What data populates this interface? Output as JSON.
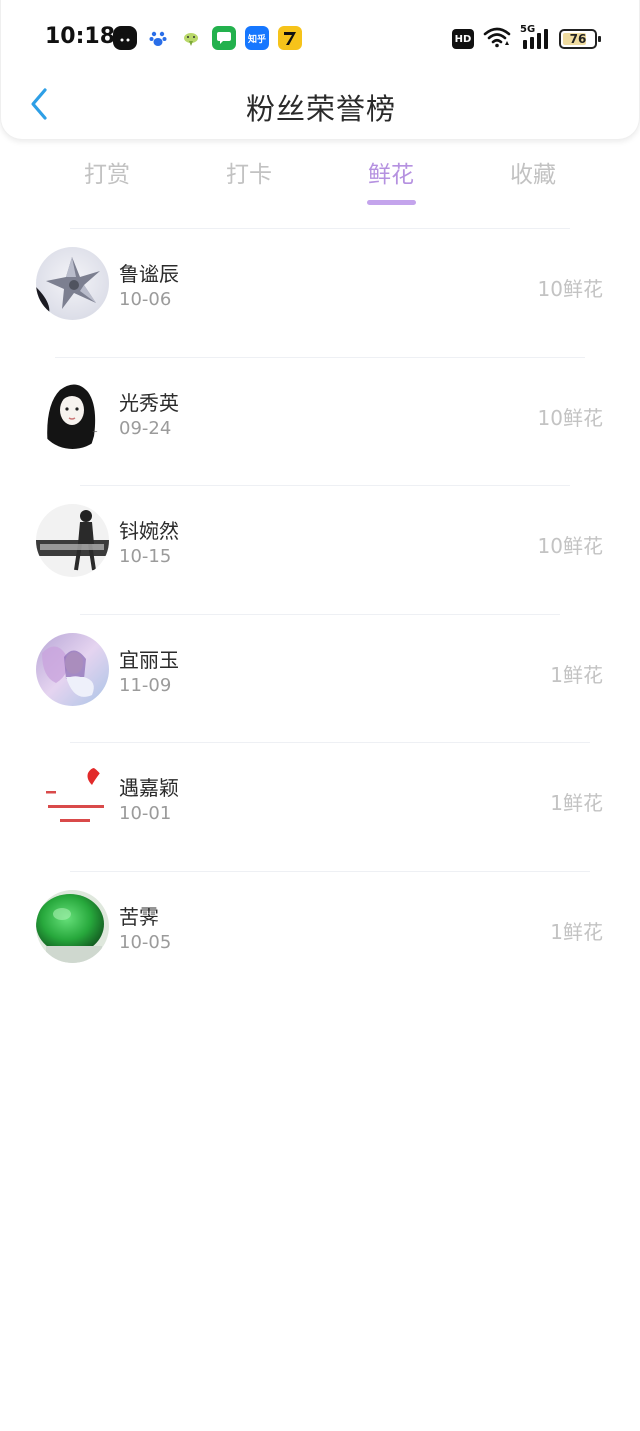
{
  "status_bar": {
    "time": "10:18",
    "hd": "HD",
    "network": "5G",
    "battery": "76",
    "battery_level": 0.76,
    "app_icons": [
      "panda-app-icon",
      "baidu-paw-icon",
      "bird-app-icon",
      "message-app-icon",
      "zhihu-app-icon",
      "qimao-app-icon"
    ],
    "zhihu_label": "知乎"
  },
  "header": {
    "title": "粉丝荣誉榜"
  },
  "tabs": [
    {
      "label": "打赏",
      "active": false
    },
    {
      "label": "打卡",
      "active": false
    },
    {
      "label": "鲜花",
      "active": true
    },
    {
      "label": "收藏",
      "active": false
    }
  ],
  "colors": {
    "accent": "#b591e0",
    "back_arrow": "#2e9fe6",
    "text_primary": "#2b2b2b",
    "text_muted": "#9b9b9b",
    "text_amount": "#c3c3c3"
  },
  "fans": [
    {
      "name": "鲁谧辰",
      "date": "10-06",
      "amount": "10鲜花"
    },
    {
      "name": "光秀英",
      "date": "09-24",
      "amount": "10鲜花"
    },
    {
      "name": "钭婉然",
      "date": "10-15",
      "amount": "10鲜花"
    },
    {
      "name": "宜丽玉",
      "date": "11-09",
      "amount": "1鲜花"
    },
    {
      "name": "遇嘉颖",
      "date": "10-01",
      "amount": "1鲜花"
    },
    {
      "name": "苦霁",
      "date": "10-05",
      "amount": "1鲜花"
    }
  ]
}
